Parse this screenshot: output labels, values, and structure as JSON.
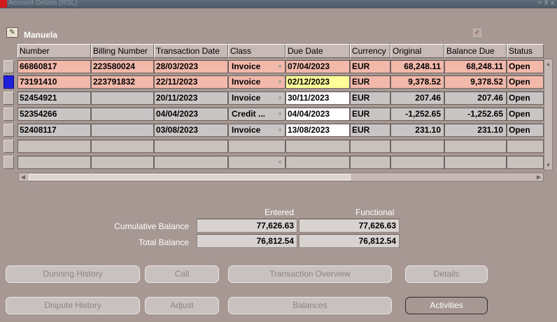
{
  "window": {
    "title": "Account Details (RSL)",
    "controls": "= ⊼ x"
  },
  "customer": {
    "name": "Manuela",
    "checkbox_mark": "✓"
  },
  "columns": [
    "Number",
    "Billing Number",
    "Transaction Date",
    "Class",
    "Due Date",
    "Currency",
    "Original",
    "Balance Due",
    "Status"
  ],
  "rows": [
    {
      "number": "66860817",
      "billing": "223580024",
      "date": "28/03/2023",
      "class": "Invoice",
      "due": "07/04/2023",
      "currency": "EUR",
      "original": "68,248.11",
      "balance": "68,248.11",
      "status": "Open"
    },
    {
      "number": "73191410",
      "billing": "223791832",
      "date": "22/11/2023",
      "class": "Invoice",
      "due": "02/12/2023",
      "currency": "EUR",
      "original": "9,378.52",
      "balance": "9,378.52",
      "status": "Open"
    },
    {
      "number": "52454921",
      "billing": "",
      "date": "20/11/2023",
      "class": "Invoice",
      "due": "30/11/2023",
      "currency": "EUR",
      "original": "207.46",
      "balance": "207.46",
      "status": "Open"
    },
    {
      "number": "52354266",
      "billing": "",
      "date": "04/04/2023",
      "class": "Credit ...",
      "due": "04/04/2023",
      "currency": "EUR",
      "original": "-1,252.65",
      "balance": "-1,252.65",
      "status": "Open"
    },
    {
      "number": "52408117",
      "billing": "",
      "date": "03/08/2023",
      "class": "Invoice",
      "due": "13/08/2023",
      "currency": "EUR",
      "original": "231.10",
      "balance": "231.10",
      "status": "Open"
    }
  ],
  "totals": {
    "entered_header": "Entered",
    "functional_header": "Functional",
    "cumulative_label": "Cumulative Balance",
    "cumulative_entered": "77,626.63",
    "cumulative_functional": "77,626.63",
    "total_label": "Total Balance",
    "total_entered": "76,812.54",
    "total_functional": "76,812.54"
  },
  "buttons": {
    "dunning_history": "Dunning History",
    "call": "Call",
    "transaction_overview": "Transaction Overview",
    "details": "Details",
    "dispute_history": "Dispute History",
    "adjust": "Adjust",
    "balances": "Balances",
    "activities": "Activities"
  },
  "colors": {
    "background": "#a89893",
    "highlight_row": "#f2b8aa",
    "active_field": "#ffff99",
    "selected_indicator": "#1f1fd8"
  }
}
